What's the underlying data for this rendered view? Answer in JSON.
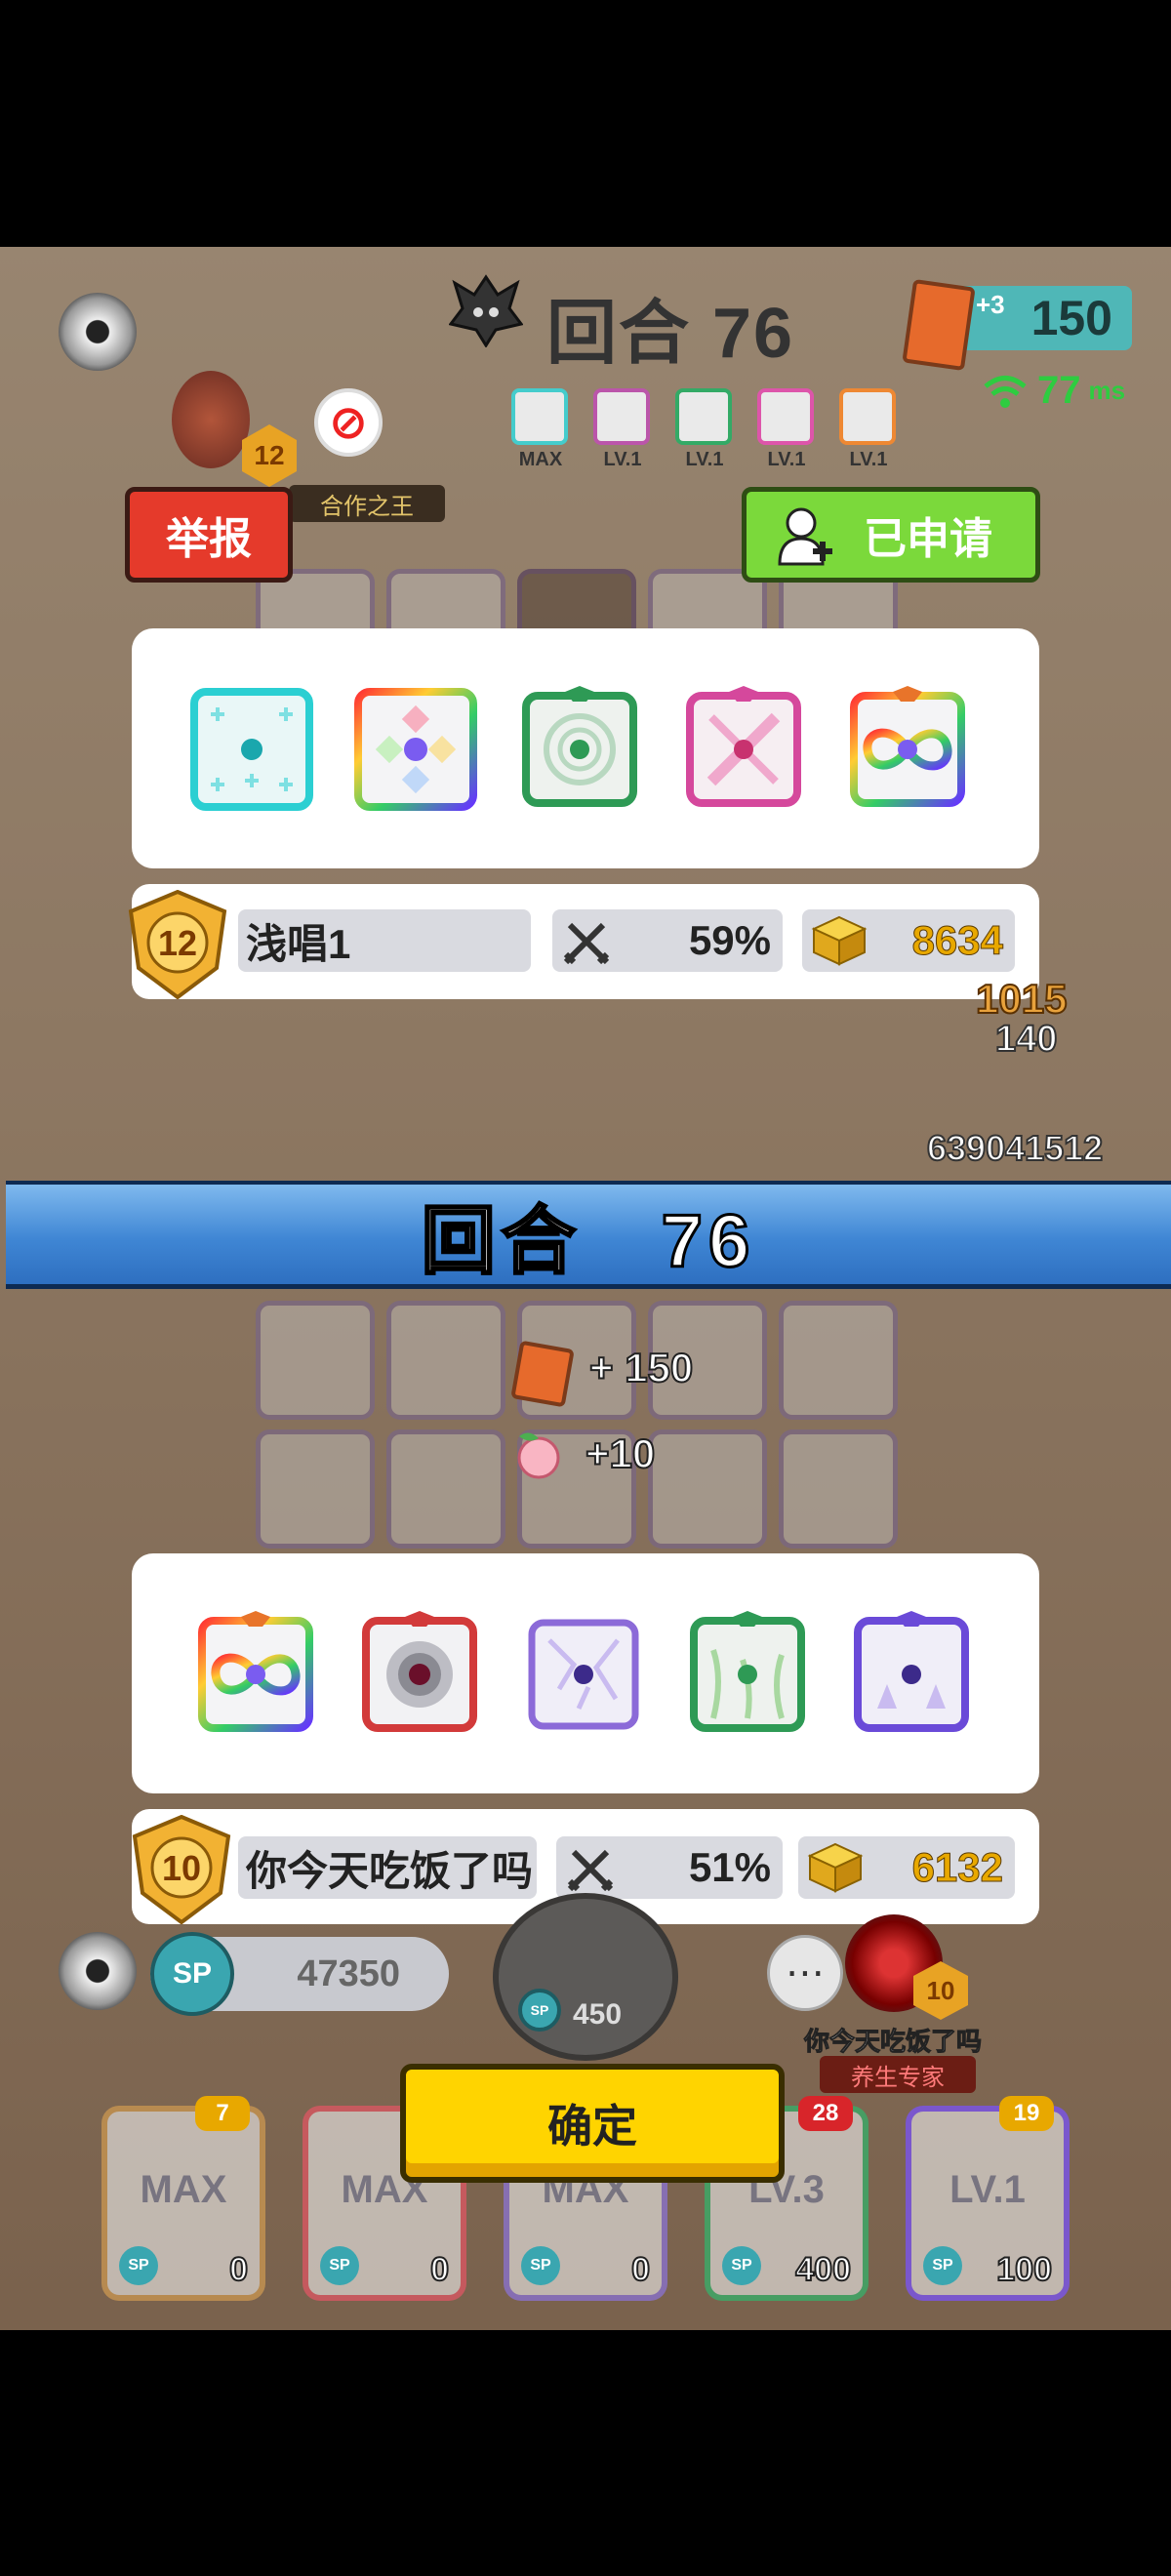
{
  "header": {
    "round_title": "回合 76",
    "card_count": "150",
    "card_plus": "+3",
    "ping_value": "77",
    "ping_unit": "ms"
  },
  "opponent": {
    "title_badge": "合作之王",
    "rank": "12",
    "upgrade_levels": [
      "MAX",
      "LV.1",
      "LV.1",
      "LV.1",
      "LV.1"
    ],
    "report_label": "举报",
    "applied_label": "已申请",
    "name": "浅唱1",
    "win_rate": "59%",
    "gold": "8634"
  },
  "round_banner": "回合　76",
  "rewards": {
    "cards": "+ 150",
    "peach": "+10"
  },
  "background_numbers": {
    "dmg1": "1015",
    "dmg2": "140",
    "boss_hp": "639041512"
  },
  "me": {
    "rank": "10",
    "name": "你今天吃饭了吗",
    "win_rate": "51%",
    "gold": "6132"
  },
  "bottom": {
    "sp_total": "47350",
    "sp_label": "SP",
    "roll_cost": "450",
    "confirm_label": "确定",
    "ally_name": "你今天吃饭了吗",
    "ally_title": "养生专家",
    "ally_rank": "10",
    "chat_icon": "ellipsis-icon"
  },
  "deck": [
    {
      "level": "MAX",
      "cost": "0",
      "badge": "7",
      "badge_color": "#e8a800"
    },
    {
      "level": "MAX",
      "cost": "0",
      "badge": "",
      "badge_color": ""
    },
    {
      "level": "MAX",
      "cost": "0",
      "badge": "",
      "badge_color": ""
    },
    {
      "level": "LV.3",
      "cost": "400",
      "badge": "28",
      "badge_color": "#d8252a"
    },
    {
      "level": "LV.1",
      "cost": "100",
      "badge": "19",
      "badge_color": "#e8a800"
    }
  ],
  "colors": {
    "report_red": "#e53a2b",
    "applied_green": "#7bd93b",
    "banner_blue": "#3f86d4",
    "confirm_yellow": "#ffd400",
    "gold_text": "#e8a800"
  }
}
